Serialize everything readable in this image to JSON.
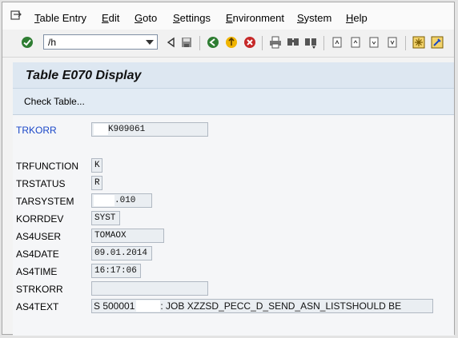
{
  "menu": {
    "items": [
      {
        "label": "Table Entry",
        "u": "T",
        "rest": "able Entry"
      },
      {
        "label": "Edit",
        "u": "E",
        "rest": "dit"
      },
      {
        "label": "Goto",
        "u": "G",
        "rest": "oto"
      },
      {
        "label": "Settings",
        "u": "S",
        "rest": "ettings"
      },
      {
        "label": "Environment",
        "u": "E",
        "rest": "nvironment"
      },
      {
        "label": "System",
        "u": "S",
        "rest": "ystem"
      },
      {
        "label": "Help",
        "u": "H",
        "rest": "elp"
      }
    ]
  },
  "toolbar": {
    "command_value": "/h"
  },
  "title": "Table E070 Display",
  "app_toolbar": {
    "check_table_label": "Check Table..."
  },
  "fields": {
    "trkorr": {
      "label": "TRKORR",
      "value": "K909061"
    },
    "trfunction": {
      "label": "TRFUNCTION",
      "value": "K"
    },
    "trstatus": {
      "label": "TRSTATUS",
      "value": "R"
    },
    "tarsystem": {
      "label": "TARSYSTEM",
      "value": ".010"
    },
    "korrdev": {
      "label": "KORRDEV",
      "value": "SYST"
    },
    "as4user": {
      "label": "AS4USER",
      "value": "TOMAOX"
    },
    "as4date": {
      "label": "AS4DATE",
      "value": "09.01.2014"
    },
    "as4time": {
      "label": "AS4TIME",
      "value": "16:17:06"
    },
    "strkorr": {
      "label": "STRKORR",
      "value": ""
    },
    "as4text": {
      "label": "AS4TEXT",
      "value_prefix": "S 500001",
      "value_suffix": ": JOB XZZSD_PECC_D_SEND_ASN_LISTSHOULD BE"
    }
  }
}
